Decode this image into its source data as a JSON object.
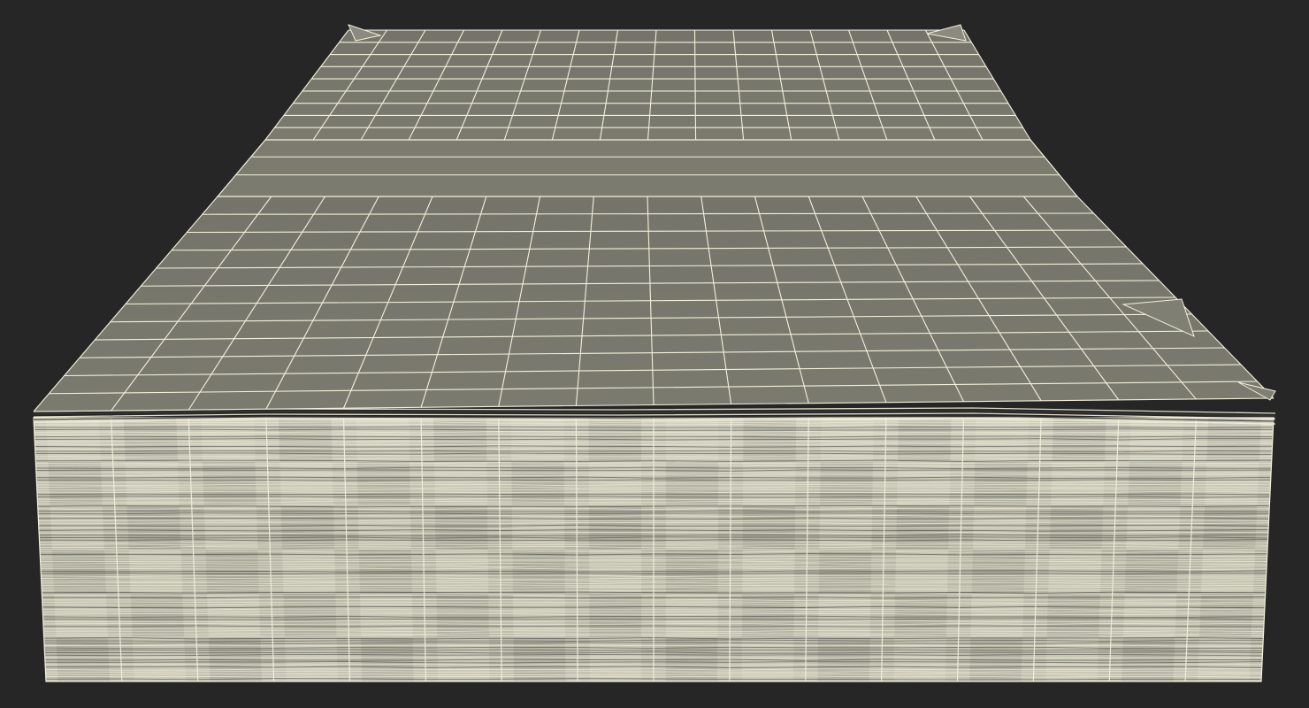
{
  "scene": {
    "subject": "wireframe-money-stack",
    "colors": {
      "background": "#262626",
      "top_surface": "#77776b",
      "band": "#7b7b70",
      "side_base": "#b9b7a6",
      "side_light": "#dcdac9",
      "side_dark": "#5e5d54",
      "wire": "#f3f1dc",
      "wire_dark": "#3a3a34"
    },
    "grid": {
      "top_far_columns": 16,
      "top_far_rows": 9,
      "top_near_columns": 16,
      "top_near_rows": 12,
      "side_columns": 16,
      "side_layers": 110
    }
  }
}
